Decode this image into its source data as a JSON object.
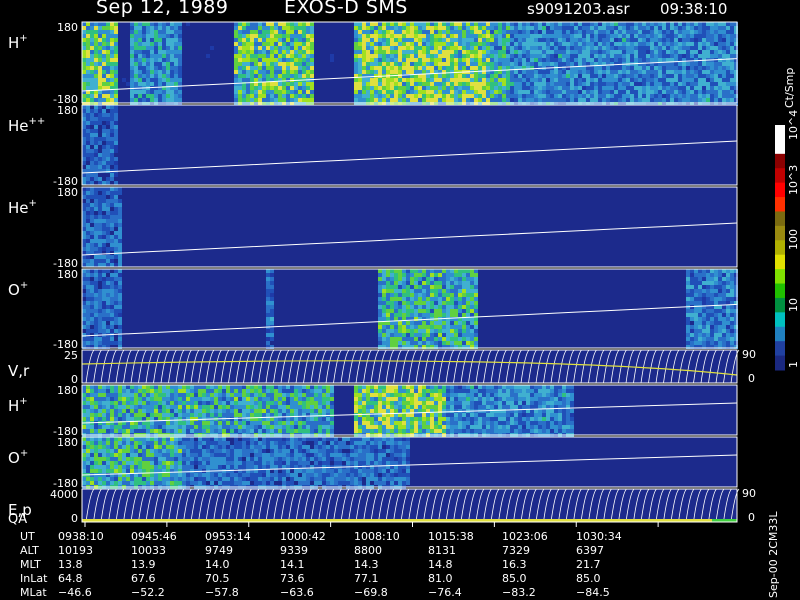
{
  "header": {
    "date": "Sep 12, 1989",
    "instrument": "EXOS-D SMS",
    "file": "s9091203.asr",
    "time": "09:38:10"
  },
  "colorbar": {
    "unit": "Ct/Smp",
    "labels": [
      "10^4",
      "10^3",
      "100",
      "10",
      "1"
    ],
    "colors": [
      "#ffffff",
      "#ffffff",
      "#8b0000",
      "#c00000",
      "#ff0000",
      "#ff3000",
      "#7a6a10",
      "#9a8a10",
      "#b0b000",
      "#e0e000",
      "#80e000",
      "#20c000",
      "#009040",
      "#00c0c0",
      "#2080c0",
      "#2040a0",
      "#1a2880"
    ]
  },
  "side_label": "Sep-00 2CM33L",
  "chart_data": {
    "type": "heatmap",
    "panels": [
      {
        "name": "H+",
        "label": "H",
        "sup": "+",
        "ytop": "180",
        "ybot": "-180",
        "kind": "spec",
        "base": 0.55,
        "bursts": [
          [
            0.0,
            0.05,
            0.9
          ],
          [
            0.07,
            0.15,
            0.6
          ],
          [
            0.23,
            0.35,
            0.9
          ],
          [
            0.41,
            0.62,
            1.0
          ],
          [
            0.62,
            0.65,
            0.8
          ],
          [
            0.65,
            1.0,
            0.55
          ]
        ]
      },
      {
        "name": "He++",
        "label": "He",
        "sup": "++",
        "ytop": "180",
        "ybot": "-180",
        "kind": "spec",
        "base": 0.1,
        "bursts": [
          [
            0.0,
            0.05,
            0.4
          ]
        ]
      },
      {
        "name": "He+",
        "label": "He",
        "sup": "+",
        "ytop": "180",
        "ybot": "-180",
        "kind": "spec",
        "base": 0.1,
        "bursts": [
          [
            0.0,
            0.06,
            0.45
          ]
        ]
      },
      {
        "name": "O+",
        "label": "O",
        "sup": "+",
        "ytop": "180",
        "ybot": "-180",
        "kind": "spec",
        "base": 0.1,
        "bursts": [
          [
            0.0,
            0.06,
            0.45
          ],
          [
            0.28,
            0.29,
            0.5
          ],
          [
            0.45,
            0.6,
            0.75
          ],
          [
            0.92,
            1.0,
            0.5
          ]
        ]
      },
      {
        "name": "V,r",
        "label": "V,r",
        "sup": "",
        "ytop": "25",
        "ybot": "0",
        "kind": "line",
        "right": [
          "90",
          "0"
        ]
      },
      {
        "name": "H+ (2)",
        "label": "H",
        "sup": "+",
        "ytop": "180",
        "ybot": "-180",
        "kind": "spec",
        "base": 0.45,
        "bursts": [
          [
            0.0,
            0.3,
            0.75
          ],
          [
            0.3,
            0.38,
            0.7
          ],
          [
            0.41,
            0.55,
            1.0
          ],
          [
            0.55,
            0.75,
            0.55
          ]
        ]
      },
      {
        "name": "O+ (2)",
        "label": "O",
        "sup": "+",
        "ytop": "180",
        "ybot": "-180",
        "kind": "spec",
        "base": 0.3,
        "bursts": [
          [
            0.0,
            0.15,
            0.75
          ],
          [
            0.15,
            0.5,
            0.45
          ]
        ]
      },
      {
        "name": "E,p QA",
        "label": "E,p",
        "label2": "QA",
        "sup": "",
        "ytop": "4000",
        "ybot": "0",
        "kind": "line",
        "right": [
          "90",
          "0"
        ]
      }
    ],
    "table": {
      "rows": [
        {
          "label": "UT",
          "values": [
            "0938:10",
            "0945:46",
            "0953:14",
            "1000:42",
            "1008:10",
            "1015:38",
            "1023:06",
            "1030:34"
          ]
        },
        {
          "label": "ALT",
          "values": [
            "10193",
            "10033",
            "9749",
            "9339",
            "8800",
            "8131",
            "7329",
            "6397"
          ]
        },
        {
          "label": "MLT",
          "values": [
            "13.8",
            "13.9",
            "14.0",
            "14.1",
            "14.3",
            "14.8",
            "16.3",
            "21.7"
          ]
        },
        {
          "label": "InLat",
          "values": [
            "64.8",
            "67.6",
            "70.5",
            "73.6",
            "77.1",
            "81.0",
            "85.0",
            "85.0"
          ]
        },
        {
          "label": "MLat",
          "values": [
            "−46.6",
            "−52.2",
            "−57.8",
            "−63.6",
            "−69.8",
            "−76.4",
            "−83.2",
            "−84.5"
          ]
        }
      ]
    }
  }
}
